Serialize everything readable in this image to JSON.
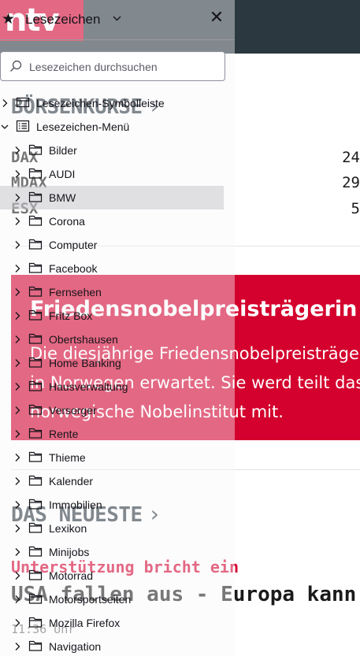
{
  "page": {
    "logo": "ntv",
    "boersen": {
      "title": "BÖRSENKURSE",
      "chevron": "›"
    },
    "indices": [
      {
        "name": "DAX",
        "value": "24"
      },
      {
        "name": "MDAX",
        "value": "29"
      },
      {
        "name": "ESX",
        "value": "5"
      }
    ],
    "breaking": {
      "title": "Friedensnobelpreisträgerin",
      "text": "Die diesjährige Friedensnobelpreisträge Landes in Norwegen erwartet. Sie werd teilt das norwegische Nobelinstitut mit."
    },
    "neueste": {
      "title": "DAS NEUESTE",
      "chevron": "›"
    },
    "article": {
      "kicker": "Unterstützung bricht ein",
      "headline": "USA fallen aus - Europa kann Uk",
      "time": "11:36 Uhr"
    }
  },
  "sidebar": {
    "title": "Lesezeichen",
    "close_label": "✕",
    "search": {
      "placeholder": "Lesezeichen durchsuchen",
      "value": ""
    },
    "items": [
      {
        "label": "Lesezeichen-Symbolleiste",
        "type": "toolbar",
        "depth": 0,
        "expanded": false
      },
      {
        "label": "Lesezeichen-Menü",
        "type": "menu",
        "depth": 0,
        "expanded": true
      },
      {
        "label": "Bilder",
        "type": "folder",
        "depth": 1
      },
      {
        "label": "AUDI",
        "type": "folder",
        "depth": 1
      },
      {
        "label": "BMW",
        "type": "folder",
        "depth": 1,
        "selected": true
      },
      {
        "label": "Corona",
        "type": "folder",
        "depth": 1
      },
      {
        "label": "Computer",
        "type": "folder",
        "depth": 1
      },
      {
        "label": "Facebook",
        "type": "folder",
        "depth": 1
      },
      {
        "label": "Fernsehen",
        "type": "folder",
        "depth": 1
      },
      {
        "label": "Fritz Box",
        "type": "folder",
        "depth": 1
      },
      {
        "label": "Obertshausen",
        "type": "folder",
        "depth": 1
      },
      {
        "label": "Home Banking",
        "type": "folder",
        "depth": 1
      },
      {
        "label": "Hausverwaltung",
        "type": "folder",
        "depth": 1
      },
      {
        "label": "Versorger",
        "type": "folder",
        "depth": 1
      },
      {
        "label": "Rente",
        "type": "folder",
        "depth": 1
      },
      {
        "label": "Thieme",
        "type": "folder",
        "depth": 1
      },
      {
        "label": "Kalender",
        "type": "folder",
        "depth": 1
      },
      {
        "label": "Immobilien",
        "type": "folder",
        "depth": 1
      },
      {
        "label": "Lexikon",
        "type": "folder",
        "depth": 1
      },
      {
        "label": "Minijobs",
        "type": "folder",
        "depth": 1
      },
      {
        "label": "Motorrad",
        "type": "folder",
        "depth": 1
      },
      {
        "label": "Motorsportseiten",
        "type": "folder",
        "depth": 1
      },
      {
        "label": "Mozilla Firefox",
        "type": "folder",
        "depth": 1
      },
      {
        "label": "Navigation",
        "type": "folder",
        "depth": 1
      }
    ]
  },
  "colors": {
    "accent": "#d4002d",
    "header": "#2b3840"
  }
}
